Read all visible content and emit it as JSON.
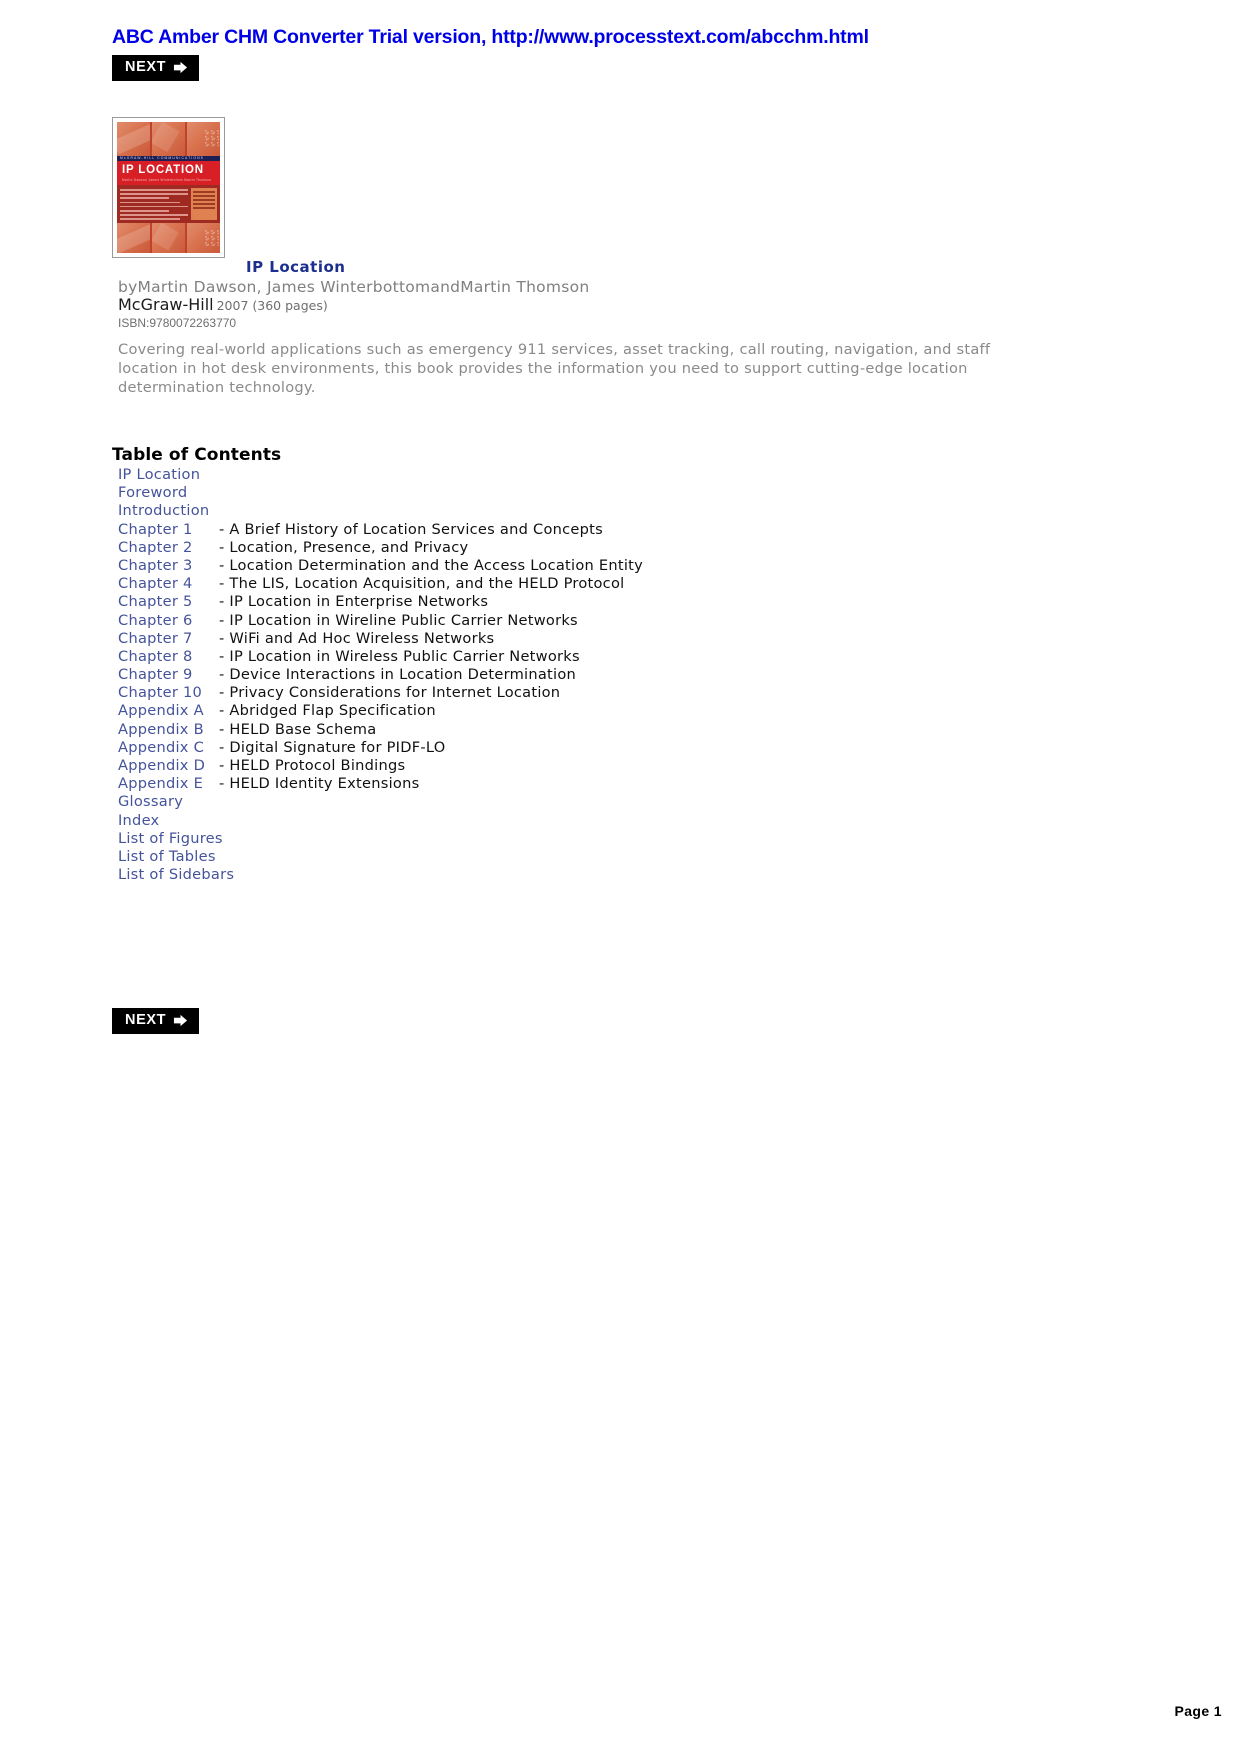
{
  "banner": {
    "text": "ABC Amber CHM Converter Trial version, http://www.processtext.com/abcchm.html",
    "color": "#0000e8"
  },
  "nav": {
    "next_label": "NEXT",
    "arrow_icon": "➤"
  },
  "cover": {
    "alt": "IP Location book cover",
    "imprint": "McGRAW-HILL COMMUNICATIONS",
    "title": "IP LOCATION",
    "subtitle": "Martin Dawson  James Winterbottom  Martin Thomson",
    "colors": {
      "title_band": "#d81f26",
      "imprint_band": "#1b1f55",
      "body": "#9e2a22",
      "tile": "#d9734f",
      "sidebox": "#e08152"
    }
  },
  "book": {
    "title": "IP Location",
    "byline": "byMartin Dawson, James WinterbottomandMartin Thomson",
    "publisher": "McGraw-Hill",
    "year_pages": "2007 (360 pages)",
    "isbn": "ISBN:9780072263770",
    "description": "Covering real-world applications such as emergency 911 services, asset tracking, call routing, navigation, and staff location in hot desk environments, this book provides the information you need to support cutting-edge location determination technology."
  },
  "toc": {
    "heading": "Table of Contents",
    "entries": [
      {
        "link": "IP Location",
        "title": "",
        "indexed": false
      },
      {
        "link": "Foreword",
        "title": "",
        "indexed": false
      },
      {
        "link": "Introduction",
        "title": "",
        "indexed": false
      },
      {
        "link": "Chapter 1",
        "title": "- A Brief History of Location Services and Concepts",
        "indexed": true
      },
      {
        "link": "Chapter 2",
        "title": "- Location, Presence, and Privacy",
        "indexed": true
      },
      {
        "link": "Chapter 3",
        "title": "- Location Determination and the Access Location Entity",
        "indexed": true
      },
      {
        "link": "Chapter 4",
        "title": "- The LIS, Location Acquisition, and the HELD Protocol",
        "indexed": true
      },
      {
        "link": "Chapter 5",
        "title": "- IP Location in Enterprise Networks",
        "indexed": true
      },
      {
        "link": "Chapter 6",
        "title": "- IP Location in Wireline Public Carrier Networks",
        "indexed": true
      },
      {
        "link": "Chapter 7",
        "title": "- WiFi and Ad Hoc Wireless Networks",
        "indexed": true
      },
      {
        "link": "Chapter 8",
        "title": "- IP Location in Wireless Public Carrier Networks",
        "indexed": true
      },
      {
        "link": "Chapter 9",
        "title": "- Device Interactions in Location Determination",
        "indexed": true
      },
      {
        "link": "Chapter 10",
        "title": "- Privacy Considerations for Internet Location",
        "indexed": true
      },
      {
        "link": "Appendix A",
        "title": "- Abridged Flap Specification",
        "indexed": true
      },
      {
        "link": "Appendix B",
        "title": "- HELD Base Schema",
        "indexed": true
      },
      {
        "link": "Appendix C",
        "title": "- Digital Signature for PIDF-LO",
        "indexed": true
      },
      {
        "link": "Appendix D",
        "title": "- HELD Protocol Bindings",
        "indexed": true
      },
      {
        "link": "Appendix E",
        "title": "- HELD Identity Extensions",
        "indexed": true
      },
      {
        "link": "Glossary",
        "title": "",
        "indexed": false
      },
      {
        "link": "Index",
        "title": "",
        "indexed": false
      },
      {
        "link": "List of Figures",
        "title": "",
        "indexed": false
      },
      {
        "link": "List of Tables",
        "title": "",
        "indexed": false
      },
      {
        "link": "List of Sidebars",
        "title": "",
        "indexed": false
      }
    ]
  },
  "footer": {
    "page_label": "Page 1"
  }
}
